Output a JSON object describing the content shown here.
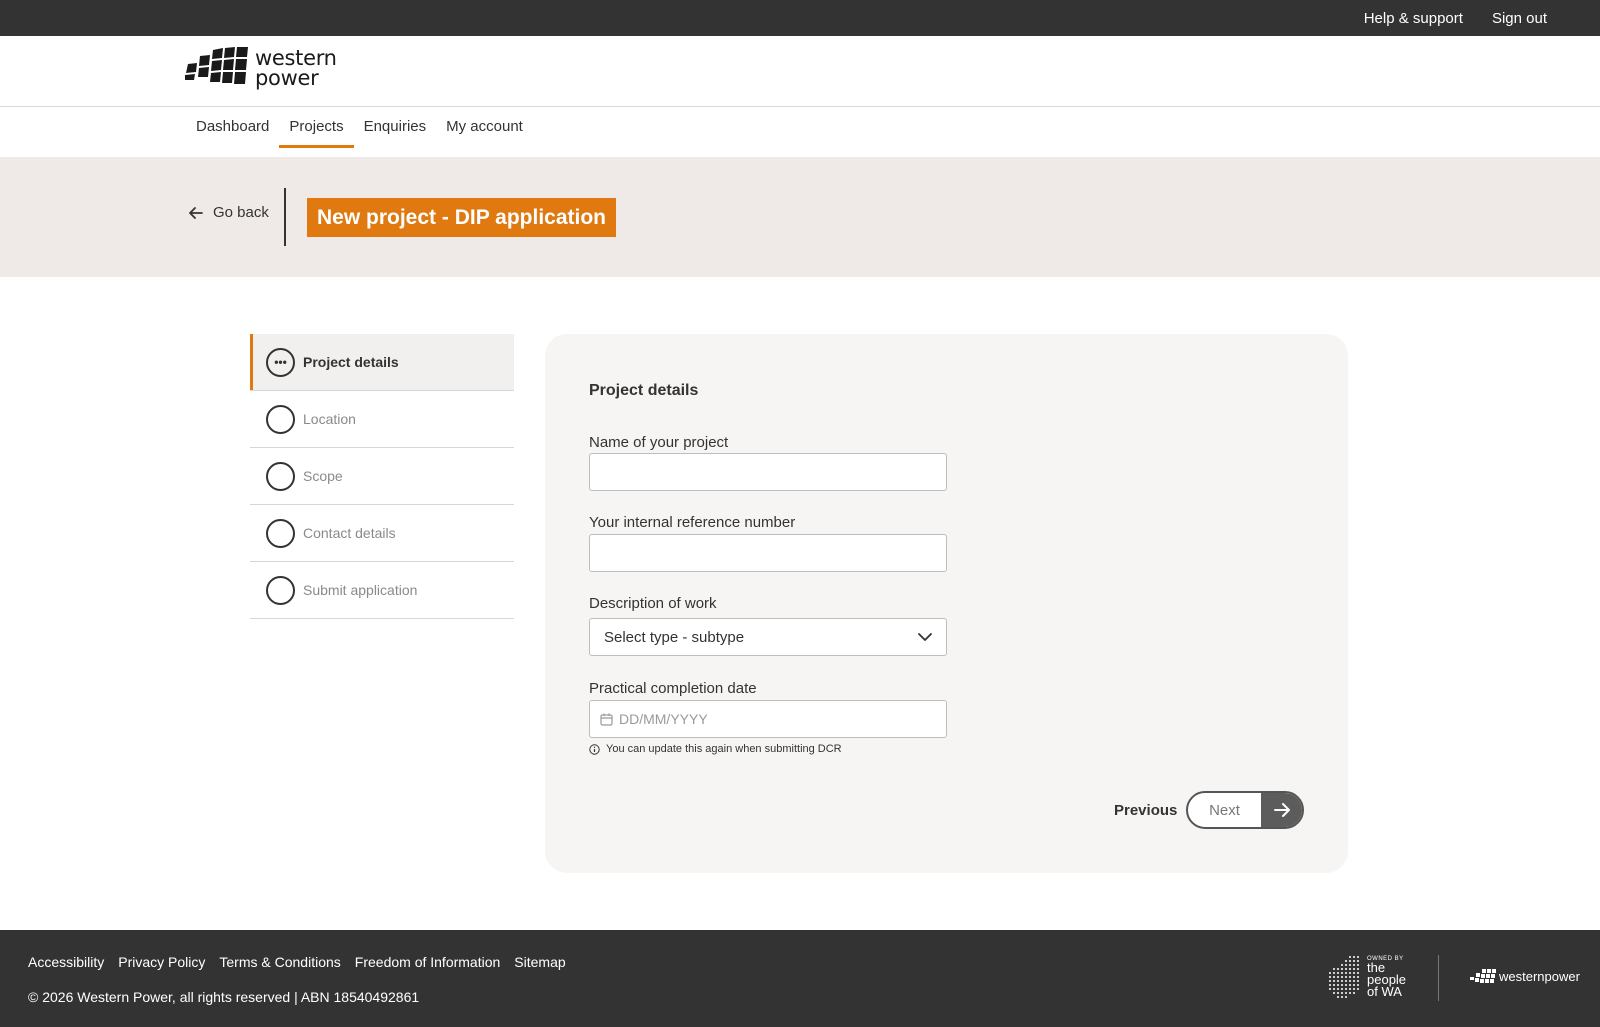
{
  "topbar": {
    "help": "Help & support",
    "signout": "Sign out"
  },
  "logo": {
    "line1": "western",
    "line2": "power"
  },
  "nav": {
    "items": [
      {
        "label": "Dashboard"
      },
      {
        "label": "Projects"
      },
      {
        "label": "Enquiries"
      },
      {
        "label": "My account"
      }
    ],
    "active": "Projects"
  },
  "hero": {
    "back": "Go back",
    "title": "New project - DIP application"
  },
  "steps": [
    {
      "label": "Project details",
      "status": "in-progress"
    },
    {
      "label": "Location",
      "status": "not-started"
    },
    {
      "label": "Scope",
      "status": "not-started"
    },
    {
      "label": "Contact details",
      "status": "not-started"
    },
    {
      "label": "Submit application",
      "status": "not-started"
    }
  ],
  "form": {
    "title": "Project details",
    "name_label": "Name of your project",
    "name_value": "",
    "ref_label": "Your internal reference number",
    "ref_value": "",
    "desc_label": "Description of work",
    "desc_value": "Select type - subtype",
    "date_label": "Practical completion date",
    "date_placeholder": "DD/MM/YYYY",
    "hint": "You can update this again when submitting DCR",
    "previous": "Previous",
    "next": "Next"
  },
  "footer": {
    "links": [
      "Accessibility",
      "Privacy Policy",
      "Terms & Conditions",
      "Freedom of Information",
      "Sitemap"
    ],
    "copyright": "© 2026 Western Power, all rights reserved | ABN 18540492861",
    "owned_by": "OWNED BY",
    "owned_line1": "the",
    "owned_line2": "people",
    "owned_line3": "of WA",
    "logo_text": "westernpower"
  },
  "colors": {
    "accent": "#e07a10",
    "dark": "#333333",
    "hero_bg": "#efeae8",
    "card_bg": "#f6f5f4"
  }
}
